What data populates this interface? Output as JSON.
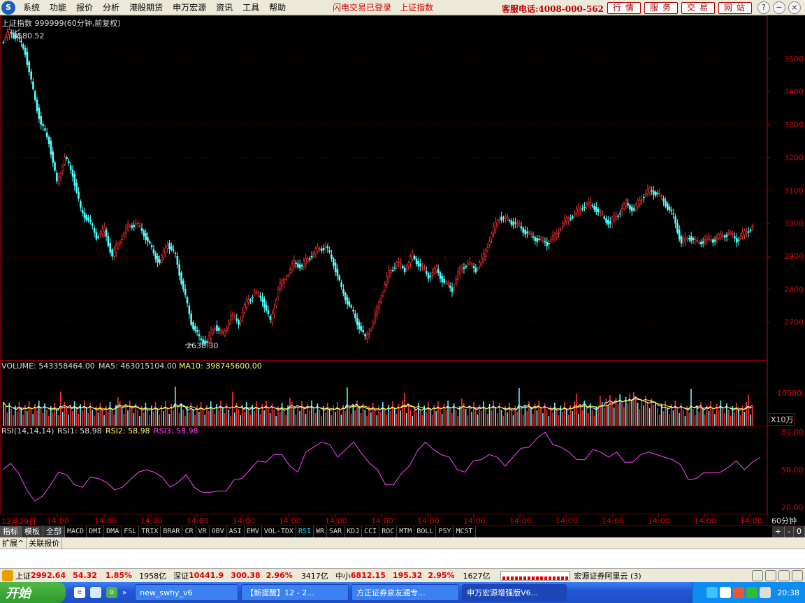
{
  "menubar": {
    "logo": "S",
    "items": [
      "系统",
      "功能",
      "报价",
      "分析",
      "港股期货",
      "申万宏源",
      "资讯",
      "工具",
      "帮助"
    ],
    "status1": "闪电交易已登录",
    "status2": "上证指数",
    "hotline": "客服电话:4008-000-562",
    "quick": [
      "行情",
      "服务",
      "交易",
      "网站"
    ]
  },
  "chart": {
    "title": "上证指数 999999(60分钟,前复权)",
    "high_label": "3580.52",
    "low_label": "2638.30",
    "volume": {
      "label_volume": "VOLUME: 543358464.00",
      "label_ma5": "MA5: 463015104.00",
      "label_ma10": "MA10: 398745600.00",
      "unit": "X10万"
    },
    "rsi": {
      "params": "RSI(14,14,14)",
      "rsi1": "RSI1: 58.98",
      "rsi2": "RSI2: 58.98",
      "rsi3": "RSI3: 58.98"
    },
    "period": "60分钟",
    "date_label": "12月29日",
    "tick_time": "14:00",
    "nav_buttons": [
      "+",
      "-",
      "0"
    ]
  },
  "indicator_tabs": {
    "category": [
      "指标",
      "模板",
      "全部"
    ],
    "items": [
      "MACD",
      "DMI",
      "DMA",
      "FSL",
      "TRIX",
      "BRAR",
      "CR",
      "VR",
      "OBV",
      "ASI",
      "EMV",
      "VOL-TDX",
      "RSI",
      "WR",
      "SAR",
      "KDJ",
      "CCI",
      "ROC",
      "MTM",
      "BOLL",
      "PSY",
      "MCST"
    ],
    "selected": "RSI"
  },
  "section_tabs": [
    "扩展^",
    "关联报价"
  ],
  "statusbar": {
    "sh_name": "上证",
    "sh_value": "2992.64",
    "sh_chg": "54.32",
    "sh_pct": "1.85%",
    "sh_amount": "1958亿",
    "sz_name": "深证",
    "sz_value": "10441.9",
    "sz_chg": "300.38",
    "sz_pct": "2.96%",
    "sz_amount": "3417亿",
    "zx_name": "中小",
    "zx_value": "6812.15",
    "zx_chg": "195.32",
    "zx_pct": "2.95%",
    "zx_amount": "1627亿",
    "broker": "宏源证券阿里云 (3)"
  },
  "taskbar": {
    "start": "开始",
    "buttons": [
      "new_swhy_v6",
      "【新提醒】12 - 2...",
      "方正证券泉友通专...",
      "申万宏源增强版V6..."
    ],
    "clock": "20:38"
  },
  "chart_data": {
    "type": "candlestick",
    "price_axis": [
      2700,
      2800,
      2900,
      3000,
      3100,
      3200,
      3300,
      3400,
      3500
    ],
    "volume_axis": [
      10000
    ],
    "rsi_axis": [
      20.0,
      50.0,
      80.0
    ],
    "price_path": [
      3550,
      3580,
      3565,
      3520,
      3400,
      3300,
      3250,
      3120,
      3200,
      3150,
      3040,
      3010,
      2960,
      2980,
      2900,
      2950,
      2990,
      3000,
      2970,
      2920,
      2880,
      2940,
      2900,
      2800,
      2700,
      2650,
      2638,
      2690,
      2660,
      2720,
      2700,
      2760,
      2790,
      2770,
      2700,
      2800,
      2840,
      2880,
      2870,
      2900,
      2920,
      2930,
      2880,
      2800,
      2750,
      2700,
      2650,
      2700,
      2780,
      2850,
      2880,
      2860,
      2900,
      2870,
      2840,
      2860,
      2820,
      2800,
      2860,
      2880,
      2860,
      2900,
      2970,
      3020,
      3010,
      3000,
      2980,
      2960,
      2950,
      2940,
      2960,
      3000,
      3020,
      3040,
      3060,
      3050,
      3020,
      3000,
      3030,
      3060,
      3040,
      3080,
      3100,
      3090,
      3060,
      3020,
      2940,
      2960,
      2940,
      2950,
      2950,
      2960,
      2970,
      2950,
      2970,
      2990
    ],
    "rsi_path": [
      52,
      55,
      45,
      36,
      25,
      27,
      40,
      48,
      44,
      40,
      36,
      42,
      45,
      40,
      32,
      38,
      42,
      46,
      52,
      48,
      42,
      38,
      40,
      44,
      38,
      32,
      30,
      35,
      33,
      40,
      45,
      50,
      55,
      58,
      62,
      60,
      55,
      48,
      62,
      70,
      72,
      68,
      62,
      66,
      70,
      65,
      55,
      48,
      40,
      38,
      45,
      55,
      65,
      70,
      68,
      62,
      58,
      52,
      48,
      55,
      60,
      62,
      58,
      55,
      60,
      65,
      70,
      75,
      78,
      72,
      68,
      62,
      60,
      58,
      64,
      66,
      60,
      62,
      58,
      56,
      60,
      66,
      62,
      58,
      60,
      54,
      40,
      45,
      48,
      46,
      50,
      52,
      55,
      52,
      56,
      58
    ]
  }
}
